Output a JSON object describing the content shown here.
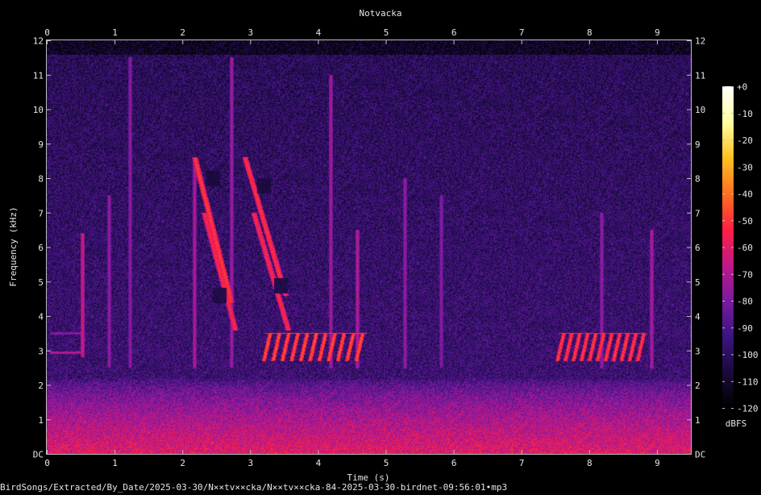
{
  "chart_data": {
    "type": "heatmap",
    "title": "Notvacka",
    "xlabel": "Time (s)",
    "ylabel": "Frequency (kHz)",
    "xlim": [
      0,
      9.5
    ],
    "ylim": [
      0,
      12
    ],
    "x_ticks": [
      "0",
      "1",
      "2",
      "3",
      "4",
      "5",
      "6",
      "7",
      "8",
      "9"
    ],
    "y_ticks": [
      "DC",
      "1",
      "2",
      "3",
      "4",
      "5",
      "6",
      "7",
      "8",
      "9",
      "10",
      "11",
      "12"
    ],
    "colorbar": {
      "label": "dBFS",
      "ticks": [
        "+0",
        "-10",
        "-20",
        "-30",
        "-40",
        "-50",
        "-60",
        "-70",
        "-80",
        "-90",
        "-100",
        "-110",
        "-120"
      ],
      "range": [
        -120,
        0
      ],
      "colormap": [
        "#000000",
        "#1a0a3c",
        "#3c1480",
        "#7a1aa0",
        "#c0188a",
        "#ff2040",
        "#ff7020",
        "#ffc020",
        "#ffffa0",
        "#ffffff"
      ]
    },
    "background_noise_db": -95,
    "low_freq_noise": {
      "top_khz": 2.2,
      "level_db": -60
    },
    "noise_ceiling_khz": 11.6,
    "events": [
      {
        "kind": "stripe",
        "t": 0.52,
        "f_low": 2.8,
        "f_high": 6.4,
        "db": -62
      },
      {
        "kind": "stripe",
        "t": 0.92,
        "f_low": 2.5,
        "f_high": 7.5,
        "db": -72
      },
      {
        "kind": "stripe",
        "t": 1.22,
        "f_low": 2.5,
        "f_high": 11.5,
        "db": -74
      },
      {
        "kind": "stripe",
        "t": 2.18,
        "f_low": 2.5,
        "f_high": 8.5,
        "db": -68
      },
      {
        "kind": "stripe",
        "t": 2.72,
        "f_low": 2.5,
        "f_high": 11.5,
        "db": -70
      },
      {
        "kind": "stripe",
        "t": 4.18,
        "f_low": 2.5,
        "f_high": 11.0,
        "db": -70
      },
      {
        "kind": "stripe",
        "t": 4.58,
        "f_low": 2.5,
        "f_high": 6.5,
        "db": -66
      },
      {
        "kind": "stripe",
        "t": 5.28,
        "f_low": 2.5,
        "f_high": 8.0,
        "db": -72
      },
      {
        "kind": "stripe",
        "t": 5.82,
        "f_low": 2.5,
        "f_high": 7.5,
        "db": -74
      },
      {
        "kind": "stripe",
        "t": 8.18,
        "f_low": 2.5,
        "f_high": 7.0,
        "db": -72
      },
      {
        "kind": "stripe",
        "t": 8.92,
        "f_low": 2.5,
        "f_high": 6.5,
        "db": -68
      },
      {
        "kind": "sweep",
        "t_start": 2.18,
        "f_start": 8.6,
        "t_end": 2.72,
        "f_end": 4.4,
        "db": -48
      },
      {
        "kind": "sweep",
        "t_start": 2.32,
        "f_start": 7.0,
        "t_end": 2.78,
        "f_end": 3.6,
        "db": -52
      },
      {
        "kind": "sweep",
        "t_start": 2.92,
        "f_start": 8.6,
        "t_end": 3.52,
        "f_end": 4.6,
        "db": -50
      },
      {
        "kind": "sweep",
        "t_start": 3.05,
        "f_start": 7.0,
        "t_end": 3.56,
        "f_end": 3.6,
        "db": -52
      },
      {
        "kind": "trill",
        "t_start": 3.22,
        "t_end": 4.72,
        "f_low": 2.7,
        "f_high": 3.5,
        "count": 11,
        "db": -45
      },
      {
        "kind": "trill",
        "t_start": 7.55,
        "t_end": 8.85,
        "f_low": 2.7,
        "f_high": 3.5,
        "count": 11,
        "db": -48
      },
      {
        "kind": "tone",
        "t_start": 0.05,
        "t_end": 0.52,
        "f": 2.95,
        "db": -66
      },
      {
        "kind": "tone",
        "t_start": 0.05,
        "t_end": 0.5,
        "f": 3.5,
        "db": -74
      },
      {
        "kind": "blob",
        "t": 2.45,
        "f": 8.0,
        "db": -110
      },
      {
        "kind": "blob",
        "t": 3.2,
        "f": 7.8,
        "db": -110
      },
      {
        "kind": "blob",
        "t": 2.55,
        "f": 4.6,
        "db": -108
      },
      {
        "kind": "blob",
        "t": 3.45,
        "f": 4.9,
        "db": -108
      }
    ]
  },
  "footer": {
    "file_path": "BirdSongs/Extracted/By_Date/2025-03-30/N××tv××cka/N××tv××cka-84-2025-03-30-birdnet-09:56:01•mp3"
  }
}
